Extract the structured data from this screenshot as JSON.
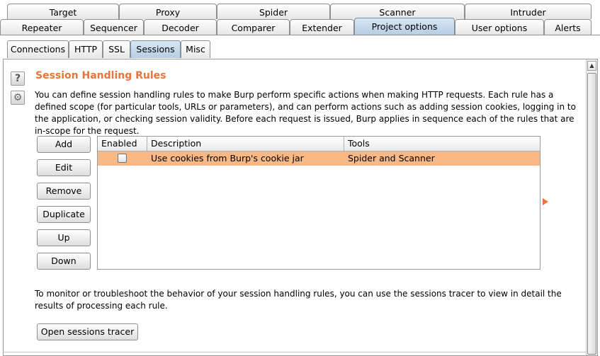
{
  "top_tabs_row1": [
    {
      "label": "Target"
    },
    {
      "label": "Proxy"
    },
    {
      "label": "Spider"
    },
    {
      "label": "Scanner"
    },
    {
      "label": "Intruder"
    }
  ],
  "top_tabs_row2": [
    {
      "label": "Repeater"
    },
    {
      "label": "Sequencer"
    },
    {
      "label": "Decoder"
    },
    {
      "label": "Comparer"
    },
    {
      "label": "Extender"
    },
    {
      "label": "Project options"
    },
    {
      "label": "User options"
    },
    {
      "label": "Alerts"
    }
  ],
  "sub_tabs": [
    {
      "label": "Connections"
    },
    {
      "label": "HTTP"
    },
    {
      "label": "SSL"
    },
    {
      "label": "Sessions"
    },
    {
      "label": "Misc"
    }
  ],
  "section": {
    "help_glyph": "?",
    "gear_glyph": "⚙",
    "title": "Session Handling Rules",
    "description": "You can define session handling rules to make Burp perform specific actions when making HTTP requests. Each rule has a defined scope (for particular tools, URLs or parameters), and can perform actions such as adding session cookies, logging in to the application, or checking session validity. Before each request is issued, Burp applies in sequence each of the rules that are in-scope for the request."
  },
  "buttons": {
    "add": "Add",
    "edit": "Edit",
    "remove": "Remove",
    "duplicate": "Duplicate",
    "up": "Up",
    "down": "Down"
  },
  "table": {
    "columns": [
      "Enabled",
      "Description",
      "Tools"
    ],
    "rows": [
      {
        "enabled": false,
        "description": "Use cookies from Burp's cookie jar",
        "tools": "Spider and Scanner"
      }
    ]
  },
  "monitor": {
    "text": "To monitor or troubleshoot the behavior of your session handling rules, you can use the sessions tracer to view in detail the results of processing each rule.",
    "tracer_button": "Open sessions tracer"
  },
  "colors": {
    "accent": "#e8743b",
    "selected_row": "#f8b986",
    "active_tab": "#c6d8ea"
  },
  "icons": {
    "help": "help-icon",
    "settings": "gear-icon",
    "scroll_up": "scroll-up-icon",
    "selection_marker": "arrow-right-icon"
  }
}
